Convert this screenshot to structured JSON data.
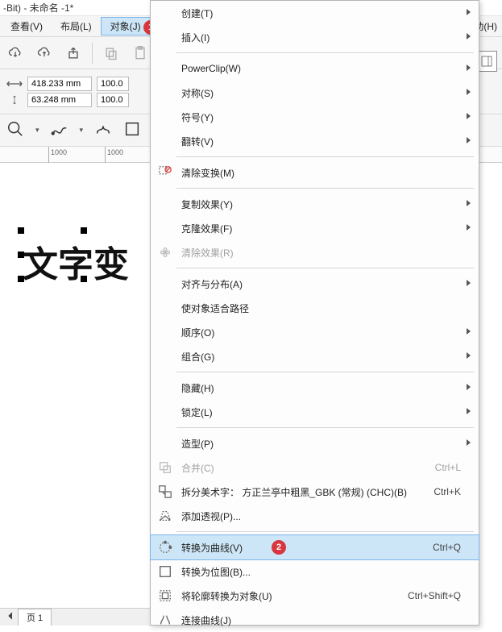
{
  "title_bar": "-Bit) - 未命名 -1*",
  "menubar": {
    "view": "查看(V)",
    "layout": "布局(L)",
    "object": "对象(J)",
    "help": "助(H)"
  },
  "badges": {
    "menu": "1",
    "convert": "2"
  },
  "propbar": {
    "width_value": "418.233 mm",
    "height_value": "63.248 mm",
    "scale_x": "100.0",
    "scale_y": "100.0"
  },
  "ruler": {
    "tick1": "1000",
    "tick2": "1000"
  },
  "canvas_text": "文字变",
  "bottom_tab": "页 1",
  "menu": {
    "create": "创建(T)",
    "insert": "插入(I)",
    "powerclip": "PowerClip(W)",
    "symmetry": "对称(S)",
    "symbol": "符号(Y)",
    "flip": "翻转(V)",
    "clear_transform": "清除变换(M)",
    "copy_effects": "复制效果(Y)",
    "clone_effects": "克隆效果(F)",
    "clear_effects": "清除效果(R)",
    "align_dist": "对齐与分布(A)",
    "fit_to_path": "使对象适合路径",
    "order": "顺序(O)",
    "group": "组合(G)",
    "hide": "隐藏(H)",
    "lock": "锁定(L)",
    "shaping": "造型(P)",
    "combine": "合并(C)",
    "combine_sc": "Ctrl+L",
    "break_apart": "拆分美术字： 方正兰亭中粗黑_GBK (常规) (CHC)(B)",
    "break_sc": "Ctrl+K",
    "add_perspective": "添加透视(P)...",
    "to_curves": "转换为曲线(V)",
    "to_curves_sc": "Ctrl+Q",
    "to_bitmap": "转换为位图(B)...",
    "outline_to_obj": "将轮廓转换为对象(U)",
    "outline_sc": "Ctrl+Shift+Q",
    "join_curves": "连接曲线(J)"
  }
}
